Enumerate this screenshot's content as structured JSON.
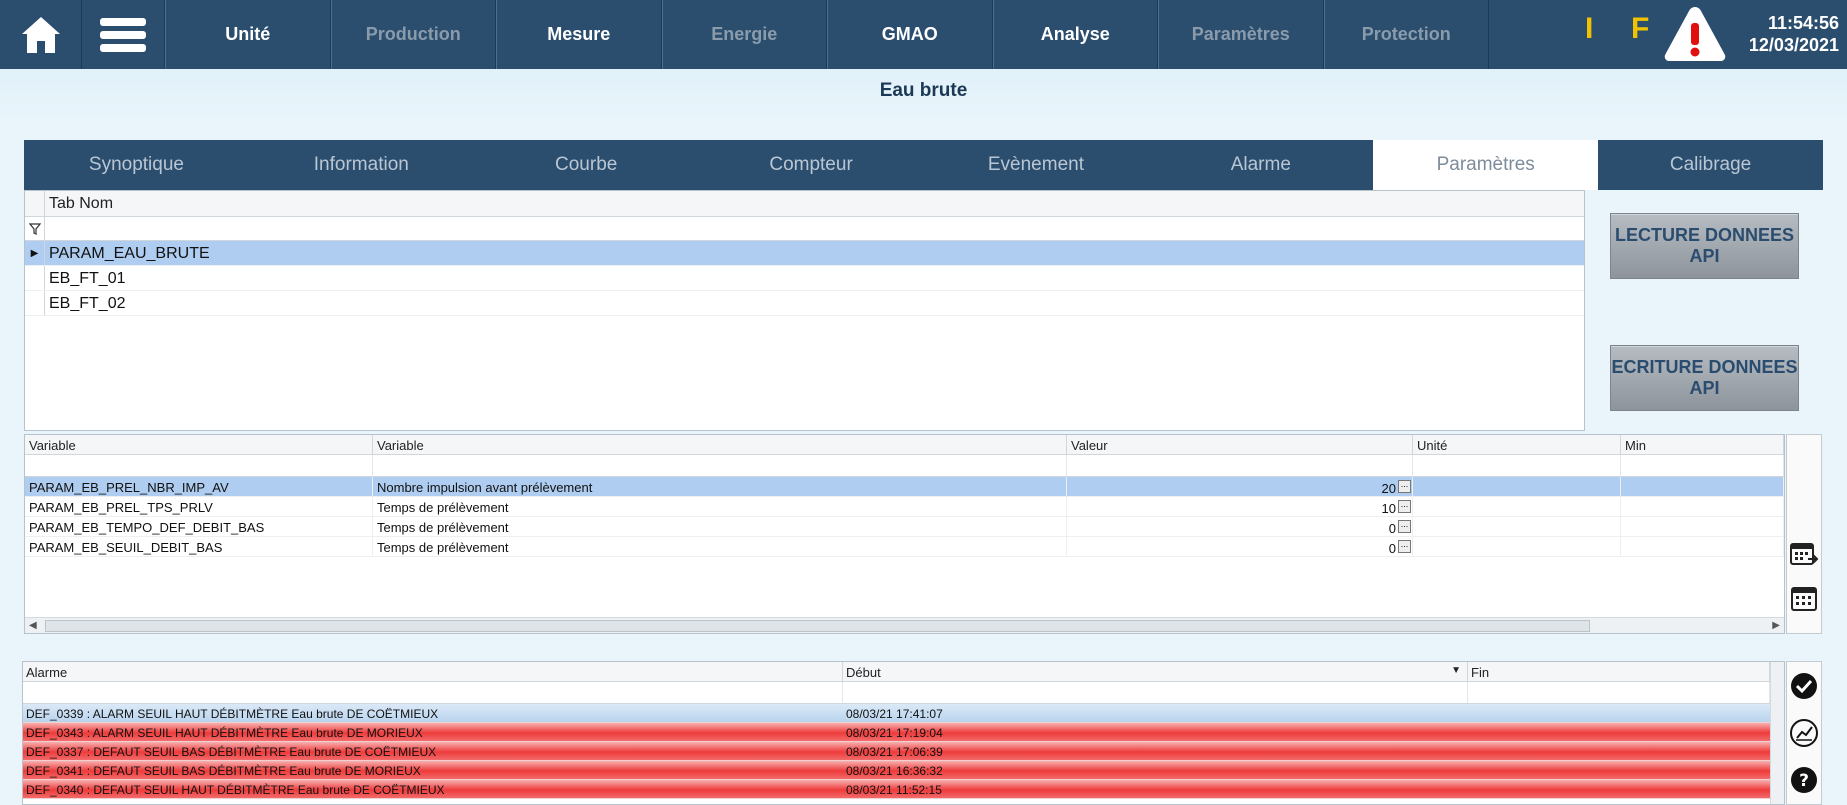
{
  "nav": {
    "items": [
      {
        "label": "Unité",
        "state": "active"
      },
      {
        "label": "Production",
        "state": "dim"
      },
      {
        "label": "Mesure",
        "state": "active"
      },
      {
        "label": "Energie",
        "state": "dim"
      },
      {
        "label": "GMAO",
        "state": "active"
      },
      {
        "label": "Analyse",
        "state": "active"
      },
      {
        "label": "Paramètres",
        "state": "dim"
      },
      {
        "label": "Protection",
        "state": "dim"
      }
    ],
    "indicator_i": "I",
    "indicator_f": "F",
    "time": "11:54:56",
    "date": "12/03/2021"
  },
  "page_title": "Eau brute",
  "tabs": [
    "Synoptique",
    "Information",
    "Courbe",
    "Compteur",
    "Evènement",
    "Alarme",
    "Paramètres",
    "Calibrage"
  ],
  "selected_tab": "Paramètres",
  "table_grid": {
    "header": "Tab Nom",
    "rows": [
      "PARAM_EAU_BRUTE",
      "EB_FT_01",
      "EB_FT_02"
    ]
  },
  "buttons": {
    "read": "LECTURE DONNEES API",
    "write": "ECRITURE DONNEES API"
  },
  "variables_grid": {
    "headers": [
      "Variable",
      "Variable",
      "Valeur",
      "Unité",
      "Min"
    ],
    "rows": [
      {
        "name": "PARAM_EB_PREL_NBR_IMP_AV",
        "label": "Nombre impulsion avant prélèvement",
        "value": "20"
      },
      {
        "name": "PARAM_EB_PREL_TPS_PRLV",
        "label": "Temps de prélèvement",
        "value": "10"
      },
      {
        "name": "PARAM_EB_TEMPO_DEF_DEBIT_BAS",
        "label": "Temps de prélèvement",
        "value": "0"
      },
      {
        "name": "PARAM_EB_SEUIL_DEBIT_BAS",
        "label": "Temps de prélèvement",
        "value": "0"
      }
    ]
  },
  "alarms_grid": {
    "headers": [
      "Alarme",
      "Début",
      "Fin"
    ],
    "rows": [
      {
        "text": "DEF_0339 : ALARM SEUIL HAUT DÉBITMÈTRE Eau brute DE COËTMIEUX",
        "start": "08/03/21 17:41:07",
        "end": "",
        "state": "ack"
      },
      {
        "text": "DEF_0343 : ALARM SEUIL HAUT DÉBITMÈTRE Eau brute DE MORIEUX",
        "start": "08/03/21 17:19:04",
        "end": "",
        "state": "alarm"
      },
      {
        "text": "DEF_0337 : DEFAUT SEUIL BAS DÉBITMÈTRE Eau brute DE COËTMIEUX",
        "start": "08/03/21 17:06:39",
        "end": "",
        "state": "alarm"
      },
      {
        "text": "DEF_0341 : DEFAUT SEUIL BAS DÉBITMÈTRE Eau brute DE MORIEUX",
        "start": "08/03/21 16:36:32",
        "end": "",
        "state": "alarm"
      },
      {
        "text": "DEF_0340 : DEFAUT SEUIL HAUT DÉBITMÈTRE Eau brute DE COËTMIEUX",
        "start": "08/03/21 11:52:15",
        "end": "",
        "state": "alarm"
      }
    ]
  },
  "colors": {
    "navbar": "#2b4e6f",
    "accent_yellow": "#f2c200",
    "selection": "#aecdf0",
    "alarm_red": "#ee3b3b"
  },
  "icons": [
    "home-icon",
    "menu-icon",
    "warning-icon",
    "calendar-export-icon",
    "calendar-icon",
    "check-icon",
    "chart-icon",
    "help-icon",
    "filter-icon"
  ]
}
